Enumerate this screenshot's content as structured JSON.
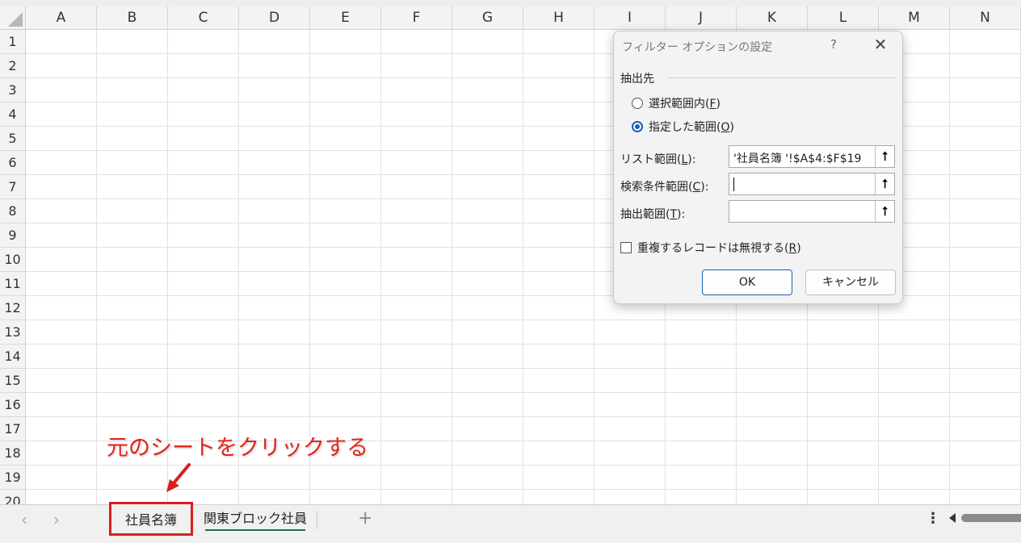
{
  "spreadsheet": {
    "columns": [
      "A",
      "B",
      "C",
      "D",
      "E",
      "F",
      "G",
      "H",
      "I",
      "J",
      "K",
      "L",
      "M",
      "N"
    ],
    "rows": [
      "1",
      "2",
      "3",
      "4",
      "5",
      "6",
      "7",
      "8",
      "9",
      "10",
      "11",
      "12",
      "13",
      "14",
      "15",
      "16",
      "17",
      "18",
      "19",
      "20"
    ]
  },
  "dialog": {
    "title": "フィルター オプションの設定",
    "help": "?",
    "close": "✕",
    "destination_group": "抽出先",
    "option_in_place": {
      "text": "選択範囲内(",
      "key": "F",
      "end": ")"
    },
    "option_copy": {
      "text": "指定した範囲(",
      "key": "O",
      "end": ")"
    },
    "list_range_label": {
      "text": "リスト範囲(",
      "key": "L",
      "end": "):"
    },
    "list_range_value": "'社員名簿 '!$A$4:$F$19",
    "criteria_label": {
      "text": "検索条件範囲(",
      "key": "C",
      "end": "):"
    },
    "criteria_value": "",
    "copy_to_label": {
      "text": "抽出範囲(",
      "key": "T",
      "end": "):"
    },
    "copy_to_value": "",
    "unique_label": {
      "text": "重複するレコードは無視する(",
      "key": "R",
      "end": ")"
    },
    "ok": "OK",
    "cancel": "キャンセル"
  },
  "tabs": {
    "prev": "‹",
    "next": "›",
    "sheet1": "社員名簿",
    "sheet2": "関東ブロック社員",
    "add": "+",
    "menu": "⋮"
  },
  "annotation": "元のシートをクリックする",
  "colors": {
    "accent": "#1a5fb4",
    "highlight": "#d81e1e",
    "active_tab": "#1e7145"
  }
}
